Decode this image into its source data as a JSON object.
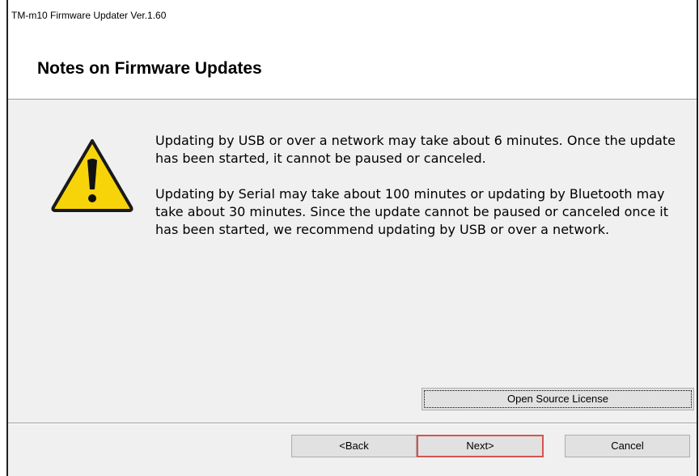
{
  "window": {
    "title": "TM-m10 Firmware Updater Ver.1.60"
  },
  "header": {
    "title": "Notes on Firmware Updates"
  },
  "content": {
    "icon": "warning-icon",
    "paragraph_1": "Updating by USB or over a network may take about 6 minutes. Once the update has been started, it cannot be paused or canceled.",
    "paragraph_2": "Updating by Serial may take about 100 minutes or updating by Bluetooth may take about 30 minutes. Since the update cannot be paused or canceled once it has been started, we recommend updating by USB or over a network."
  },
  "buttons": {
    "open_source_license": "Open Source License",
    "back": "<Back",
    "next": "Next>",
    "cancel": "Cancel"
  },
  "colors": {
    "highlight": "#d9534f",
    "warning_fill": "#f7d40a",
    "dialog_bg": "#f0f0f0"
  }
}
